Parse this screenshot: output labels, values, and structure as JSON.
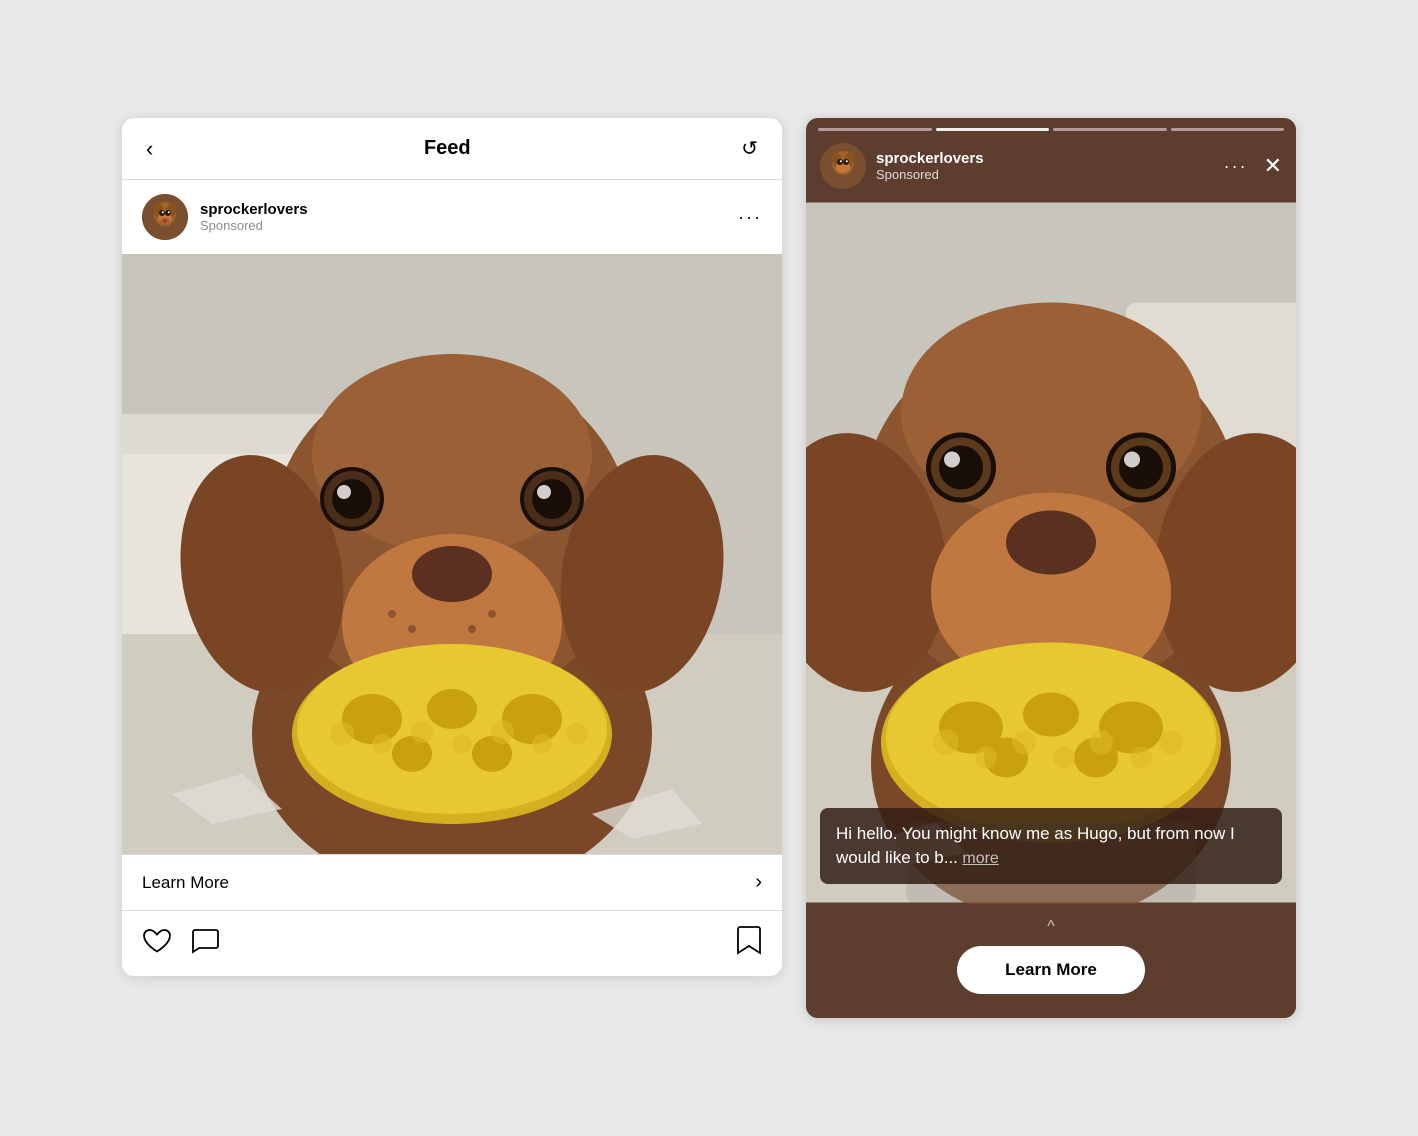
{
  "feed": {
    "title": "Feed",
    "back_label": "‹",
    "refresh_label": "↺",
    "post": {
      "username": "sprockerlovers",
      "sponsored": "Sponsored",
      "more_label": "···",
      "cta_label": "Learn More",
      "cta_arrow": "›",
      "actions": {
        "like_icon": "heart",
        "comment_icon": "comment",
        "bookmark_icon": "bookmark"
      }
    }
  },
  "story": {
    "username": "sprockerlovers",
    "sponsored": "Sponsored",
    "more_label": "···",
    "close_label": "✕",
    "caption": {
      "text": "Hi hello. You might know me as Hugo, but from now I would like to b...",
      "more_label": "more"
    },
    "swipe_up_icon": "^",
    "cta_label": "Learn More",
    "progress_segments": [
      {
        "state": "filled"
      },
      {
        "state": "active"
      },
      {
        "state": "filled"
      },
      {
        "state": "filled"
      }
    ]
  }
}
